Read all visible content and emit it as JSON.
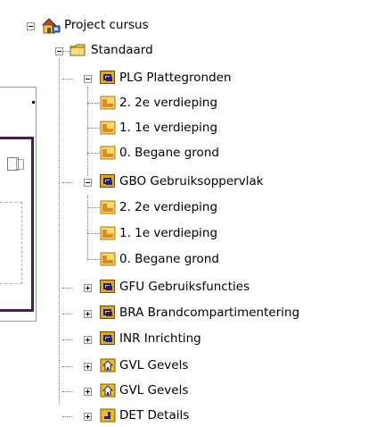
{
  "tree": {
    "root": {
      "label": "Project cursus",
      "icon": "project-icon"
    },
    "standaard": {
      "label": "Standaard",
      "icon": "folder-icon"
    },
    "groups": [
      {
        "label": "PLG Plattegronden",
        "icon": "layer-group-icon",
        "expanded": true,
        "children": [
          "2. 2e verdieping",
          "1. 1e verdieping",
          "0. Begane grond"
        ]
      },
      {
        "label": "GBO Gebruiksoppervlak",
        "icon": "layer-group-icon",
        "expanded": true,
        "children": [
          "2. 2e verdieping",
          "1. 1e verdieping",
          "0. Begane grond"
        ]
      },
      {
        "label": "GFU Gebruiksfuncties",
        "icon": "layer-group-icon",
        "expanded": false
      },
      {
        "label": "BRA Brandcompartimentering",
        "icon": "layer-group-icon",
        "expanded": false
      },
      {
        "label": "INR Inrichting",
        "icon": "layer-group-icon",
        "expanded": false
      },
      {
        "label": "GVL Gevels",
        "icon": "house-icon",
        "expanded": false
      },
      {
        "label": "GVL Gevels",
        "icon": "house-icon",
        "expanded": false
      },
      {
        "label": "DET Details",
        "icon": "detail-icon",
        "expanded": false
      }
    ]
  },
  "colors": {
    "tree_lines": "#808080",
    "folder": "#f2c94c",
    "floor_icon": "#f4c430",
    "plan_border": "#4b1b57"
  }
}
